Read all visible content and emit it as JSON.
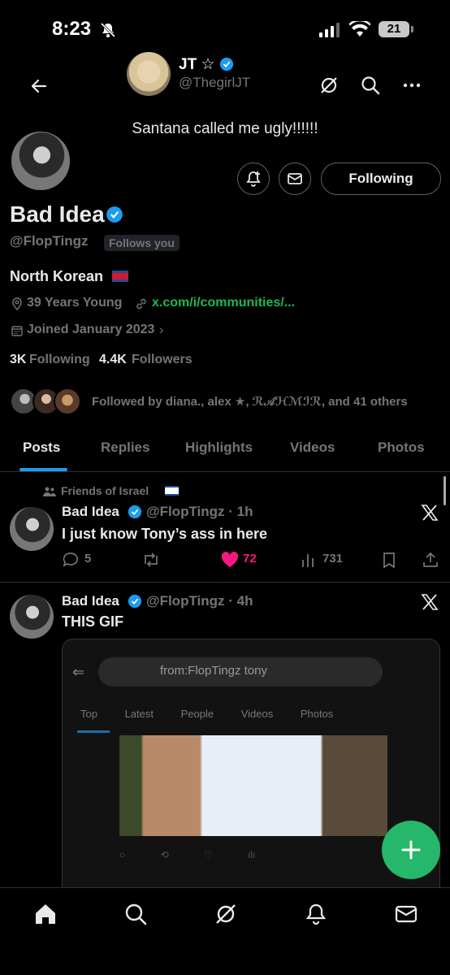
{
  "status_bar": {
    "time": "8:23",
    "battery": "21"
  },
  "context_user": {
    "name": "JT ☆",
    "handle": "@ThegirlJT",
    "status": "Santana called me ugly!!!!!!"
  },
  "profile": {
    "display_name": "Bad Idea",
    "username": "@FlopTingz",
    "follows_you": "Follows you",
    "bio": "North Korean",
    "location": "39 Years Young",
    "link": "x.com/i/communities/...",
    "joined": "Joined January 2023",
    "following_count": "3K",
    "following_label": "Following",
    "followers_count": "4.4K",
    "followers_label": "Followers",
    "followed_by": "Followed by diana., alex ★, ℛ𝒜ℋℳℐℛ, and 41 others",
    "following_button": "Following"
  },
  "tabs": [
    {
      "label": "Posts"
    },
    {
      "label": "Replies"
    },
    {
      "label": "Highlights"
    },
    {
      "label": "Videos"
    },
    {
      "label": "Photos"
    }
  ],
  "posts": [
    {
      "community": "Friends of Israel",
      "name": "Bad Idea",
      "meta": "@FlopTingz · 1h",
      "text": "I just know Tony’s ass in here",
      "replies": "5",
      "likes": "72",
      "views": "731"
    },
    {
      "name": "Bad Idea",
      "meta": "@FlopTingz · 4h",
      "text": "THIS GIF",
      "media": {
        "search_text": "from:FlopTingz tony",
        "tabs": "Top Latest People Videos Photos"
      }
    }
  ],
  "colors": {
    "accent": "#1d9bf0",
    "like": "#f91880",
    "fab": "#25b86a",
    "link": "#1db954"
  }
}
